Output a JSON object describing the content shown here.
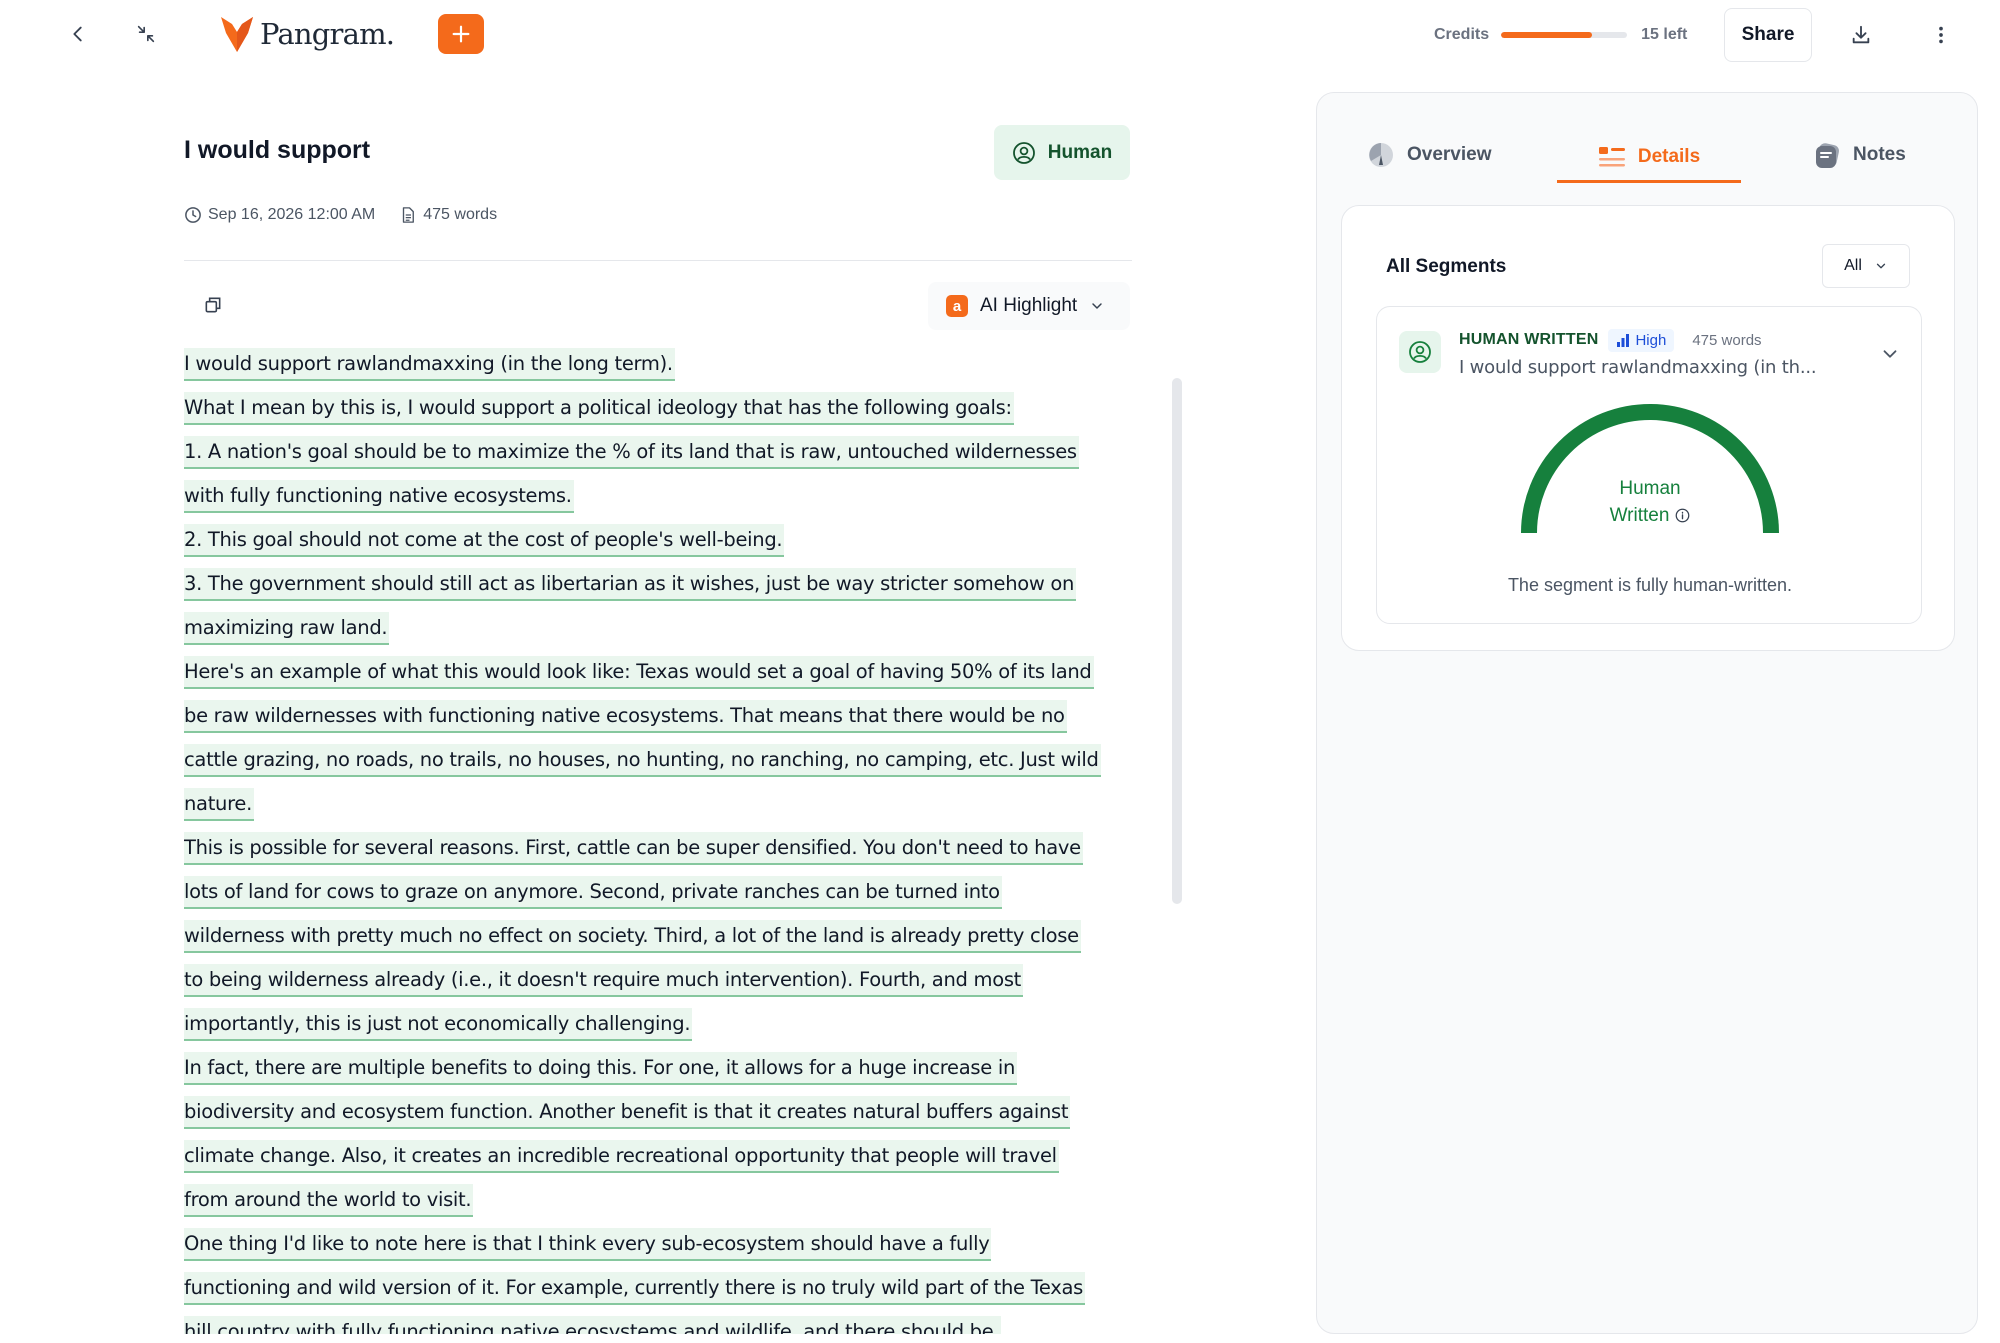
{
  "app": {
    "brand": "Pangram.",
    "accent_color": "#f46a1b"
  },
  "topbar": {
    "credits_label": "Credits",
    "credits_fraction_used": 0.72,
    "credits_left": "15 left",
    "share_label": "Share"
  },
  "document": {
    "title": "I would support",
    "classification": "Human",
    "date": "Sep 16, 2026 12:00 AM",
    "word_count": "475 words",
    "highlight_mode": "AI Highlight",
    "highlight_icon_letter": "a",
    "lines": [
      "I would support rawlandmaxxing (in the long term).",
      "What I mean by this is, I would support a political ideology that has the following goals:",
      "1. A nation's goal should be to maximize the % of its land that is raw, untouched wildernesses",
      "with fully functioning native ecosystems.",
      "2. This goal should not come at the cost of people's well-being.",
      "3. The government should still act as libertarian as it wishes, just be way stricter somehow on",
      "maximizing raw land.",
      "Here's an example of what this would look like: Texas would set a goal of having 50% of its land",
      "be raw wildernesses with functioning native ecosystems. That means that there would be no",
      "cattle grazing, no roads, no trails, no houses, no hunting, no ranching, no camping, etc. Just wild",
      "nature.",
      "This is possible for several reasons. First, cattle can be super densified. You don't need to have",
      "lots of land for cows to graze on anymore. Second, private ranches can be turned into",
      "wilderness with pretty much no effect on society. Third, a lot of the land is already pretty close",
      "to being wilderness already (i.e., it doesn't require much intervention). Fourth, and most",
      "importantly, this is just not economically challenging.",
      "In fact, there are multiple benefits to doing this. For one, it allows for a huge increase in",
      "biodiversity and ecosystem function. Another benefit is that it creates natural buffers against",
      "climate change. Also, it creates an incredible recreational opportunity that people will travel",
      "from around the world to visit.",
      "One thing I'd like to note here is that I think every sub-ecosystem should have a fully",
      "functioning and wild version of it. For example, currently there is no truly wild part of the Texas",
      "hill country with fully functioning native ecosystems and wildlife, and there should be."
    ]
  },
  "panel": {
    "tabs": [
      {
        "label": "Overview",
        "icon": "gauge-icon"
      },
      {
        "label": "Details",
        "icon": "list-icon",
        "active": true
      },
      {
        "label": "Notes",
        "icon": "notes-icon"
      }
    ],
    "segments_title": "All Segments",
    "filter_value": "All",
    "segment": {
      "kind": "HUMAN WRITTEN",
      "confidence": "High",
      "words": "475 words",
      "snippet": "I would support rawlandmaxxing (in th...",
      "gauge_line1": "Human",
      "gauge_line2": "Written",
      "human_fraction": 1.0,
      "summary": "The segment is fully human-written.",
      "color": "#16803d"
    }
  }
}
